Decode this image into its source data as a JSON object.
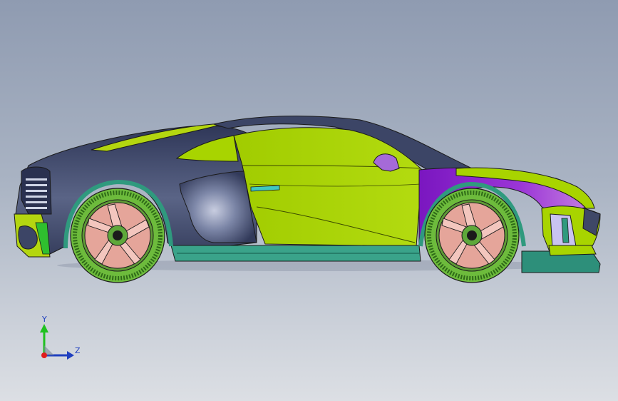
{
  "viewport": {
    "background_top": "#8f9bb1",
    "background_bottom": "#dcdfe4"
  },
  "model": {
    "name": "sports-car",
    "colors": {
      "body_dark": "#3f4867",
      "body_lime": "#a8d400",
      "front_purple": "#8a1ec4",
      "sill_teal": "#3aa38a",
      "tire": "#5ea83a",
      "rim": "#e5a59a",
      "edge": "#1b1b1b"
    }
  },
  "triad": {
    "y_label": "Y",
    "z_label": "Z",
    "y_color": "#1fc11f",
    "z_color": "#1f3fbf",
    "origin_color": "#e01c1c"
  }
}
